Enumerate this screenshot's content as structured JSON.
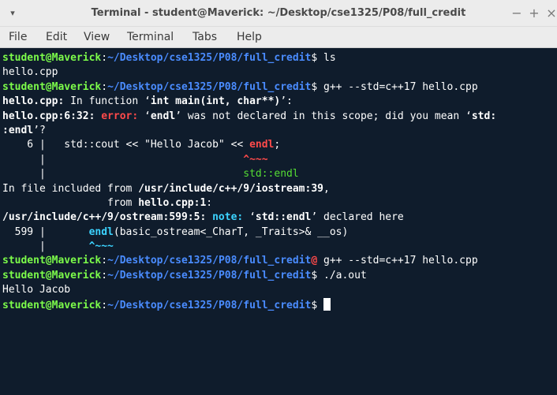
{
  "window": {
    "title": "Terminal - student@Maverick: ~/Desktop/cse1325/P08/full_credit",
    "menu_glyph": "▾",
    "minimize_glyph": "−",
    "maximize_glyph": "+",
    "close_glyph": "×"
  },
  "menubar": {
    "items": [
      "File",
      "Edit",
      "View",
      "Terminal",
      "Tabs",
      "Help"
    ]
  },
  "prompt": {
    "user_host": "student@Maverick",
    "sep": ":",
    "path": "~/Desktop/cse1325/P08/full_credit",
    "dollar": "$"
  },
  "colors": {
    "background": "#0f1c2c",
    "prompt_user": "#7cfc4a",
    "prompt_path": "#4a8cff",
    "error": "#ff4a4a",
    "note": "#3cd3ff",
    "fixit": "#55dd33"
  },
  "terminal": {
    "l1_cmd": " ls",
    "l2": "hello.cpp",
    "l3_cmd": " g++ --std=c++17 hello.cpp",
    "l4a": "hello.cpp:",
    "l4b": " In function ",
    "l4c": "‘",
    "l4d": "int main(int, char**)",
    "l4e": "’:",
    "l5a": "hello.cpp:6:32: ",
    "l5b": "error: ",
    "l5c": "‘",
    "l5d": "endl",
    "l5e": "’ was not declared in this scope; did you mean ‘",
    "l5f": "std:",
    "l6a": ":endl",
    "l6b": "’?",
    "l7a": "    6 |   std::cout << \"Hello Jacob\" << ",
    "l7b": "endl",
    "l7c": ";",
    "l8a": "      |                                ",
    "l8b": "^~~~",
    "l9a": "      |                                ",
    "l9b": "std::endl",
    "l10a": "In file included from ",
    "l10b": "/usr/include/c++/9/iostream:39",
    "l10c": ",",
    "l11a": "                 from ",
    "l11b": "hello.cpp:1",
    "l11c": ":",
    "l12a": "/usr/include/c++/9/ostream:599:5: ",
    "l12b": "note: ",
    "l12c": "‘",
    "l12d": "std::endl",
    "l12e": "’ declared here",
    "l13a": "  599 |       ",
    "l13b": "endl",
    "l13c": "(basic_ostream<_CharT, _Traits>& __os)",
    "l14a": "      |       ",
    "l14b": "^~~~",
    "l15_at": "@",
    "l15_cmd": " g++ --std=c++17 hello.cpp",
    "l16_cmd": " ./a.out",
    "l17": "Hello Jacob"
  }
}
